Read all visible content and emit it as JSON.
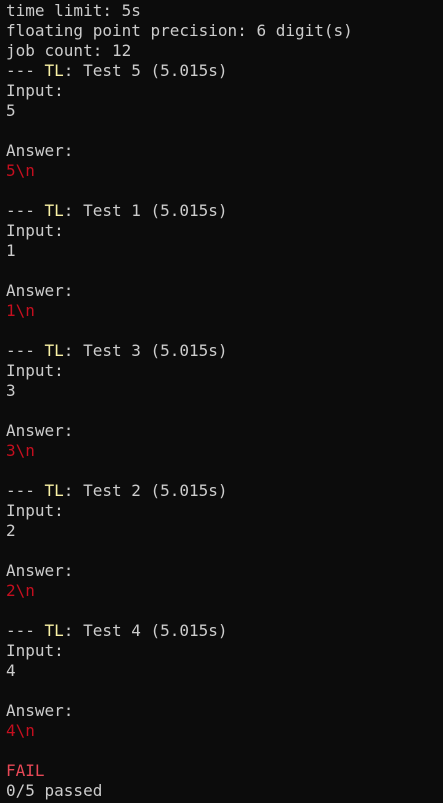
{
  "header": {
    "time_limit": "time limit: 5s",
    "precision": "floating point precision: 6 digit(s)",
    "job_count": "job count: 12"
  },
  "tests": [
    {
      "prefix": "--- ",
      "tag": "TL",
      "title": ": Test 5 (5.015s)",
      "input_label": "Input:",
      "input": "5",
      "answer_label": "Answer:",
      "answer": "5\\n"
    },
    {
      "prefix": "--- ",
      "tag": "TL",
      "title": ": Test 1 (5.015s)",
      "input_label": "Input:",
      "input": "1",
      "answer_label": "Answer:",
      "answer": "1\\n"
    },
    {
      "prefix": "--- ",
      "tag": "TL",
      "title": ": Test 3 (5.015s)",
      "input_label": "Input:",
      "input": "3",
      "answer_label": "Answer:",
      "answer": "3\\n"
    },
    {
      "prefix": "--- ",
      "tag": "TL",
      "title": ": Test 2 (5.015s)",
      "input_label": "Input:",
      "input": "2",
      "answer_label": "Answer:",
      "answer": "2\\n"
    },
    {
      "prefix": "--- ",
      "tag": "TL",
      "title": ": Test 4 (5.015s)",
      "input_label": "Input:",
      "input": "4",
      "answer_label": "Answer:",
      "answer": "4\\n"
    }
  ],
  "summary": {
    "status": "FAIL",
    "passed": "0/5 passed"
  },
  "colors": {
    "background": "#0c0c0c",
    "text": "#cccccc",
    "tl_tag": "#f9f1a5",
    "fail": "#e74856",
    "answer": "#c50f1f"
  }
}
